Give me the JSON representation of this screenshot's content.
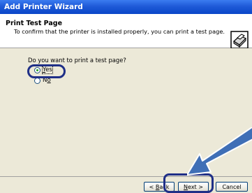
{
  "window": {
    "title": "Add Printer Wizard"
  },
  "header": {
    "title": "Print Test Page",
    "subtitle": "To confirm that the printer is installed properly, you can print a test page.",
    "icon": "printer-icon"
  },
  "main": {
    "question": "Do you want to print a test page?",
    "options": [
      {
        "label": "Yes",
        "underline_char": "Y",
        "selected": true
      },
      {
        "label": "No",
        "underline_char": "o",
        "selected": false
      }
    ]
  },
  "buttons": {
    "back": {
      "prefix": "< ",
      "mnemonic": "B",
      "rest": "ack"
    },
    "next": {
      "mnemonic": "N",
      "rest": "ext",
      "suffix": " >"
    },
    "cancel": "Cancel"
  },
  "colors": {
    "titlebar": "#0a46c8",
    "dialog_background": "#ece9d8",
    "callout": "#1f2f87",
    "arrow": "#3f6fb6"
  },
  "annotation": {
    "arrow_icon": "pointer-arrow-icon"
  }
}
